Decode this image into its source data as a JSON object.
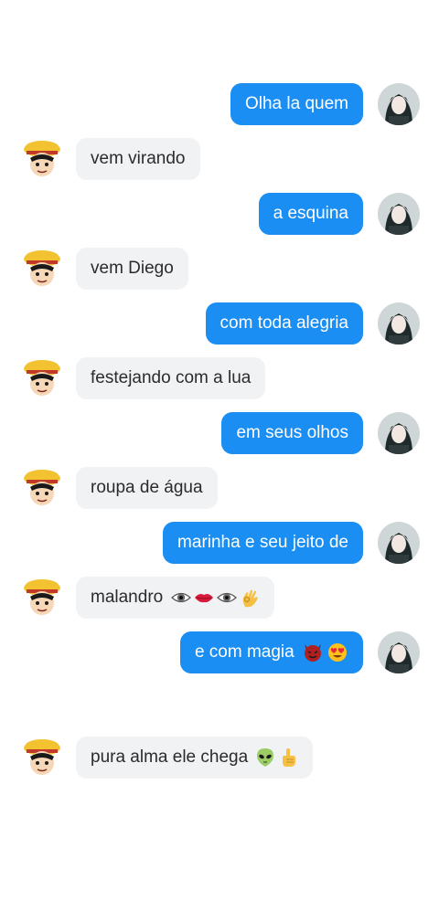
{
  "messages": [
    {
      "side": "out",
      "text": "Olha la quem",
      "emojis": []
    },
    {
      "side": "in",
      "text": "vem virando",
      "emojis": []
    },
    {
      "side": "out",
      "text": "a esquina",
      "emojis": []
    },
    {
      "side": "in",
      "text": "vem Diego",
      "emojis": []
    },
    {
      "side": "out",
      "text": "com toda alegria",
      "emojis": []
    },
    {
      "side": "in",
      "text": "festejando com a lua",
      "emojis": []
    },
    {
      "side": "out",
      "text": "em seus olhos",
      "emojis": []
    },
    {
      "side": "in",
      "text": "roupa de água",
      "emojis": []
    },
    {
      "side": "out",
      "text": "marinha e seu jeito de",
      "emojis": []
    },
    {
      "side": "in",
      "text": "malandro",
      "emojis": [
        "eye-icon",
        "lips-icon",
        "eye-icon",
        "ok-hand-icon"
      ]
    },
    {
      "side": "out",
      "text": "e com magia",
      "emojis": [
        "devil-face-icon",
        "heart-eyes-icon"
      ]
    },
    {
      "side": "in",
      "text": "pura alma ele chega",
      "emojis": [
        "alien-icon",
        "pointing-up-icon"
      ]
    }
  ],
  "colors": {
    "outgoing_bubble": "#1a8ef3",
    "incoming_bubble": "#f1f2f4"
  }
}
